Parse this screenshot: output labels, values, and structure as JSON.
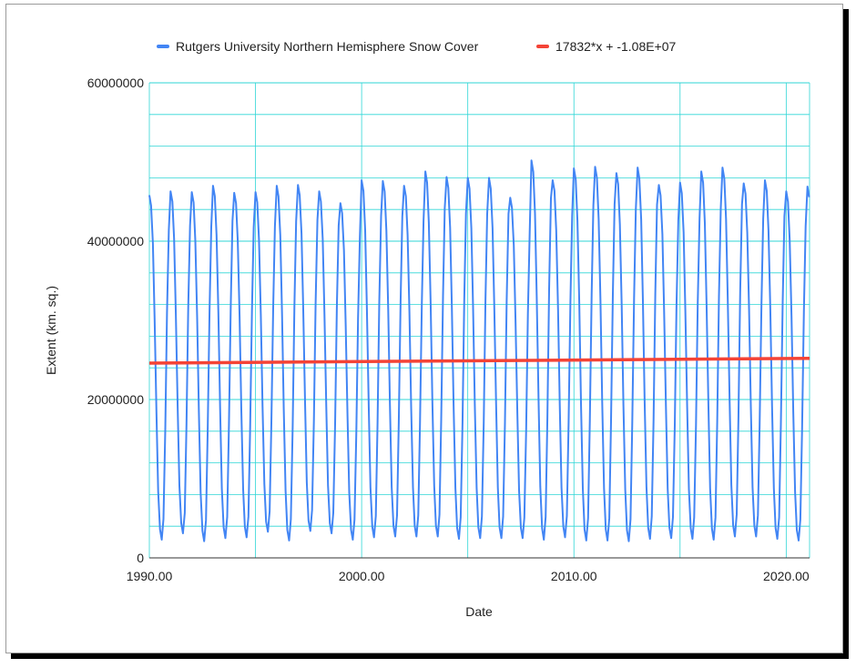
{
  "chart_data": {
    "type": "line",
    "title": "",
    "xlabel": "Date",
    "ylabel": "Extent (km. sq.)",
    "xlim": [
      1990,
      2021.1
    ],
    "ylim": [
      0,
      60000000
    ],
    "x_ticks": [
      1990,
      2000,
      2010,
      2020
    ],
    "x_tick_labels": [
      "1990.00",
      "2000.00",
      "2010.00",
      "2020.00"
    ],
    "y_ticks": [
      0,
      20000000,
      40000000,
      60000000
    ],
    "y_tick_labels": [
      "0",
      "20000000",
      "40000000",
      "60000000"
    ],
    "grid": true,
    "grid_color": "#2fd6d6",
    "legend_position": "top",
    "series": [
      {
        "name": "Rutgers University Northern Hemisphere Snow Cover",
        "color": "#4285f4",
        "kind": "monthly_cycle",
        "start_year": 1990,
        "annual_peaks": [
          45800000,
          46300000,
          46200000,
          47000000,
          46100000,
          46200000,
          47000000,
          47100000,
          46300000,
          44800000,
          47700000,
          47600000,
          47000000,
          48800000,
          48100000,
          48000000,
          48000000,
          45500000,
          50200000,
          47700000,
          49200000,
          49400000,
          48600000,
          49300000,
          47100000,
          47400000,
          48800000,
          49300000,
          47300000,
          47700000,
          46300000,
          46900000
        ],
        "annual_troughs": [
          2300000,
          3100000,
          2100000,
          2500000,
          2600000,
          3300000,
          2200000,
          3400000,
          3100000,
          2300000,
          2600000,
          2700000,
          2700000,
          2700000,
          2400000,
          2500000,
          2500000,
          2500000,
          2300000,
          2600000,
          2200000,
          2200000,
          2100000,
          2400000,
          2500000,
          2400000,
          2300000,
          2700000,
          2700000,
          2400000,
          2200000
        ]
      },
      {
        "name": "17832*x + -1.08E+07",
        "color": "#f44336",
        "kind": "trendline",
        "x": [
          1990,
          2021.1
        ],
        "y": [
          24600000,
          25200000
        ]
      }
    ]
  }
}
